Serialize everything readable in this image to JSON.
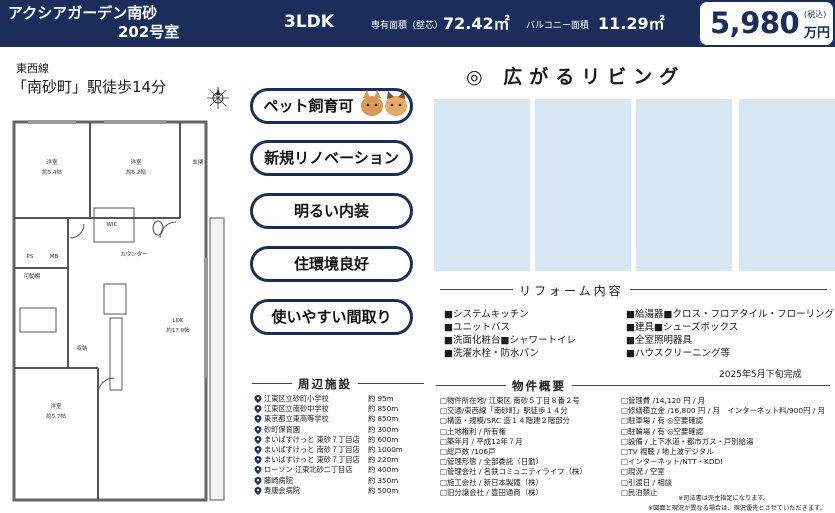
{
  "header": {
    "property_name": "アクシアガーデン南砂",
    "room": "202号室",
    "layout": "3LDK",
    "area_label": "専有面積（壁芯）",
    "area_value": "72.42㎡",
    "balcony_label": "バルコニー面積",
    "balcony_value": "11.29㎡",
    "price": "5,980",
    "price_tax": "(税込)",
    "price_unit": "万円"
  },
  "access": {
    "line": "東西線",
    "station": "「南砂町」駅徒歩14分"
  },
  "floorplan": {
    "rooms": [
      "洋室\n約5.4帖",
      "洋室\n約5.2帖",
      "洋室\n約5.7帖",
      "LDK\n約17.0帖"
    ],
    "labels": {
      "room1": "洋室",
      "room1_size": "約5.4帖",
      "room2": "洋室",
      "room2_size": "約5.2帖",
      "room3": "洋室",
      "room3_size": "約5.7帖",
      "ldk": "LDK",
      "ldk_size": "約17.0帖",
      "entrance": "玄関",
      "wic": "WIC",
      "counter": "カウンター",
      "ps": "PS",
      "mb": "MB",
      "storage": "可動棚",
      "closet": "収納"
    }
  },
  "features": [
    "ペット飼育可",
    "新規リノベーション",
    "明るい内装",
    "住環境良好",
    "使いやすい間取り"
  ],
  "living": {
    "title": "◎ 広がるリビング"
  },
  "reform": {
    "title": "リフォーム内容",
    "left": [
      "■システムキッチン",
      "■ユニットバス",
      "■洗面化粧台■シャワートイレ",
      "■洗濯水栓・防水パン"
    ],
    "right": [
      "■給湯器■クロス・フロアタイル・フローリング",
      "■建具■シューズボックス",
      "■全室照明器具",
      "■ハウスクリーニング等"
    ],
    "completion": "2025年5月下旬完成"
  },
  "surroundings": {
    "title": "周辺施設",
    "items": [
      {
        "name": "江東区立砂町小学校",
        "dist": "約 95m"
      },
      {
        "name": "江東区立南砂中学校",
        "dist": "約 850m"
      },
      {
        "name": "東京都立東高等学校",
        "dist": "約 850m"
      },
      {
        "name": "砂町保育園",
        "dist": "約 300m"
      },
      {
        "name": "まいばすけっと 東砂７丁目店",
        "dist": "約 600m"
      },
      {
        "name": "まいばすけっと 南砂７丁目店",
        "dist": "約 1000m"
      },
      {
        "name": "まいばすけっと 東砂７丁目店",
        "dist": "約 220m"
      },
      {
        "name": "ローソン 江東北砂二丁目店",
        "dist": "約 400m"
      },
      {
        "name": "藤崎病院",
        "dist": "約 350m"
      },
      {
        "name": "寿康会病院",
        "dist": "約 500m"
      }
    ]
  },
  "overview": {
    "title": "物件概要",
    "left": [
      "□物件所在地/ 江東区 南砂５丁目８番２号",
      "□交通/東西線「南砂町」駅徒歩１４分",
      "□構造・規模/SRC 造１４階建２階部分",
      "□土地権利 / 所有権",
      "□築年月 / 平成12年７月",
      "□総戸数 /106戸",
      "□管理形態 / 全部委託（日勤）",
      "□管理会社 / 名鉄コミュニティライフ（株）",
      "□施工会社 / 新日本製鐵（株）",
      "□旧分譲会社 / 豊田通商（株）"
    ],
    "right": [
      "□管理費 /14,120 円 / 月",
      "□修繕積立金 /16,800 円 / 月　インターネット料/900円 / 月",
      "□駐車場 / 有 ◎空要確認",
      "□駐輪場 / 有 ◎空要確認",
      "□設備 / 上下水道・都市ガス・戸別給湯",
      "□TV 視聴 / 地上波デジタル",
      "□インターネット/NTT・KDDI",
      "□現況 / 空室",
      "□引渡日 / 相談",
      "□民泊禁止"
    ],
    "note1": "※司法書は売主指定になります。",
    "note2": "※図面と現況が異なる場合は、現況優先とさせていただきます。"
  },
  "colors": {
    "navy": "#1b2d5a",
    "photo": "#d6e6f3"
  }
}
